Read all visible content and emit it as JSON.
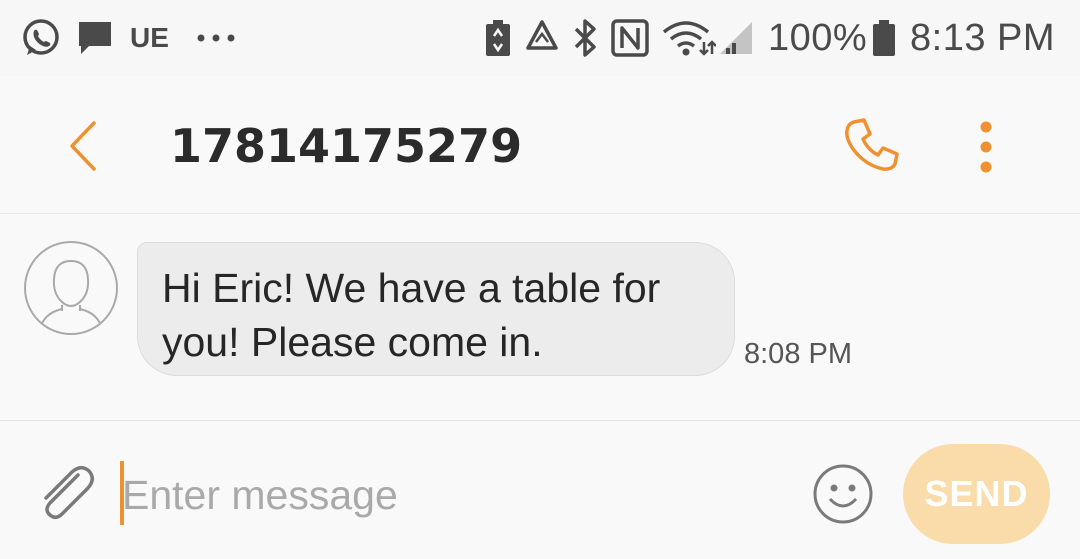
{
  "status_bar": {
    "notification_icons": [
      "whatsapp-icon",
      "message-icon"
    ],
    "ue_label": "UE",
    "more_dots": "···",
    "system_icons": [
      "battery-saver-icon",
      "recycle-icon",
      "bluetooth-icon",
      "nfc-icon",
      "wifi-icon",
      "signal-icon"
    ],
    "battery_percent": "100%",
    "time": "8:13 PM"
  },
  "header": {
    "title": "17814175279",
    "back_icon": "back-arrow-icon",
    "call_icon": "phone-icon",
    "more_icon": "more-vertical-icon"
  },
  "conversation": {
    "messages": [
      {
        "sender": "incoming",
        "text": "Hi Eric! We have a table for you! Please come in.",
        "time": "8:08 PM"
      }
    ]
  },
  "composer": {
    "placeholder": "Enter message",
    "value": "",
    "send_label": "SEND",
    "attach_icon": "paperclip-icon",
    "emoji_icon": "smiley-icon"
  },
  "colors": {
    "accent": "#f0912f",
    "send_disabled": "#f9dcaa",
    "bubble": "#ececec",
    "background": "#f9f9f9"
  }
}
